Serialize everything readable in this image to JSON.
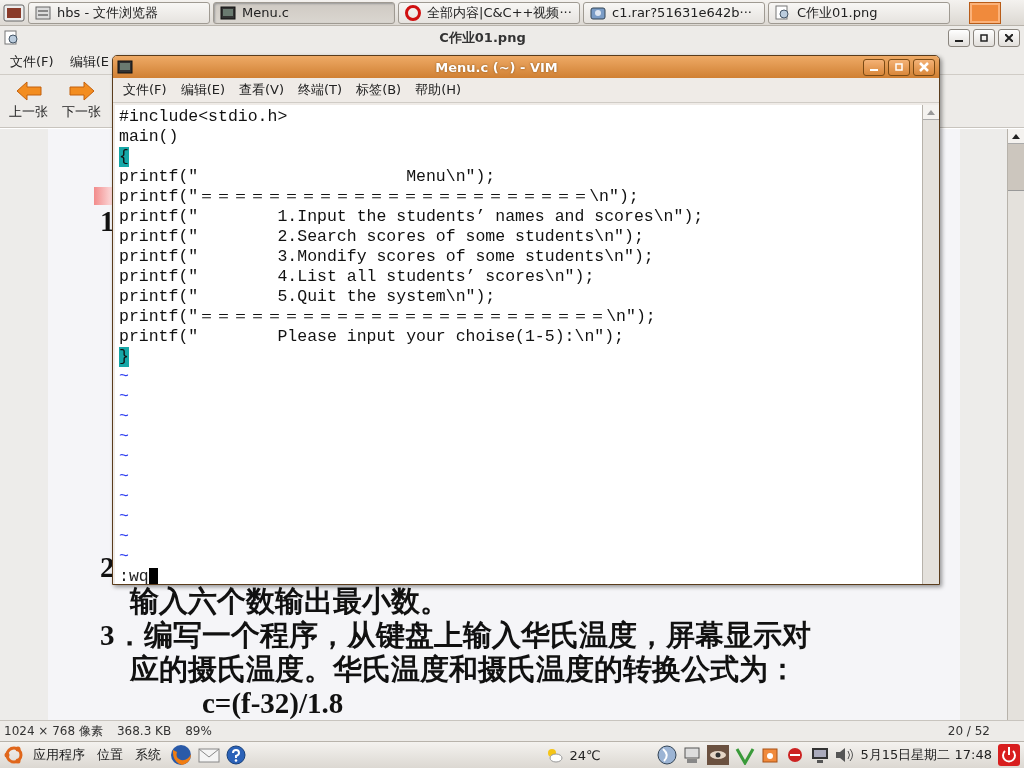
{
  "top_panel": {
    "tasks": [
      {
        "label": "hbs - 文件浏览器",
        "kind": "folder",
        "selected": false
      },
      {
        "label": "Menu.c",
        "kind": "terminal",
        "selected": true
      },
      {
        "label": "全部内容|C&C++视频···",
        "kind": "browser",
        "selected": false
      },
      {
        "label": "c1.rar?51631e642b···",
        "kind": "download",
        "selected": false
      },
      {
        "label": "C作业01.png",
        "kind": "image",
        "selected": false
      }
    ]
  },
  "viewer": {
    "title": "C作业01.png",
    "menu": [
      "文件(F)",
      "编辑(E"
    ],
    "toolbar": [
      {
        "label": "上一张",
        "kind": "prev"
      },
      {
        "label": "下一张",
        "kind": "next"
      }
    ],
    "document": {
      "top_lines": [
        "1"
      ],
      "bottom_lines": [
        {
          "text": "2",
          "kind": "number"
        },
        {
          "text": "输入六个数输出最小数。",
          "kind": "indent"
        },
        {
          "text": "3．编写一个程序，从键盘上输入华氏温度，屏幕显示对",
          "kind": "number"
        },
        {
          "text": "应的摄氏温度。华氏温度和摄氏温度的转换公式为：",
          "kind": "indent"
        },
        {
          "text": "c=(f-32)/1.8",
          "kind": "formula"
        }
      ]
    },
    "status": [
      "1024 × 768 像素",
      "368.3 KB",
      "89%"
    ],
    "page": "20 / 52"
  },
  "vim": {
    "title": "Menu.c (~) - VIM",
    "menu": [
      "文件(F)",
      "编辑(E)",
      "查看(V)",
      "终端(T)",
      "标签(B)",
      "帮助(H)"
    ],
    "lines": [
      {
        "kind": "code",
        "text": "#include<stdio.h>"
      },
      {
        "kind": "code",
        "text": "main()"
      },
      {
        "kind": "brace",
        "text": "{"
      },
      {
        "kind": "code",
        "text": "printf(\"                     Menu\\n\");"
      },
      {
        "kind": "code",
        "text": "printf(\"＝＝＝＝＝＝＝＝＝＝＝＝＝＝＝＝＝＝＝＝＝＝＝\\n\");"
      },
      {
        "kind": "code",
        "text": "printf(\"        1.Input the students’ names and scores\\n\");"
      },
      {
        "kind": "code",
        "text": "printf(\"        2.Search scores of some students\\n\");"
      },
      {
        "kind": "code",
        "text": "printf(\"        3.Mondify scores of some students\\n\");"
      },
      {
        "kind": "code",
        "text": "printf(\"        4.List all students’ scores\\n\");"
      },
      {
        "kind": "code",
        "text": "printf(\"        5.Quit the system\\n\");"
      },
      {
        "kind": "code",
        "text": "printf(\"＝＝＝＝＝＝＝＝＝＝＝＝＝＝＝＝＝＝＝＝＝＝＝＝\\n\");"
      },
      {
        "kind": "code",
        "text": "printf(\"        Please input your choise(1-5):\\n\");"
      },
      {
        "kind": "brace",
        "text": "}"
      },
      {
        "kind": "tilde",
        "text": "~"
      },
      {
        "kind": "tilde",
        "text": "~"
      },
      {
        "kind": "tilde",
        "text": "~"
      },
      {
        "kind": "tilde",
        "text": "~"
      },
      {
        "kind": "tilde",
        "text": "~"
      },
      {
        "kind": "tilde",
        "text": "~"
      },
      {
        "kind": "tilde",
        "text": "~"
      },
      {
        "kind": "tilde",
        "text": "~"
      },
      {
        "kind": "tilde",
        "text": "~"
      },
      {
        "kind": "tilde",
        "text": "~"
      }
    ],
    "command": ":wq"
  },
  "bottom_panel": {
    "menus": [
      "应用程序",
      "位置",
      "系统"
    ],
    "weather": "24℃",
    "clock": "5月15日星期二 17:48"
  }
}
